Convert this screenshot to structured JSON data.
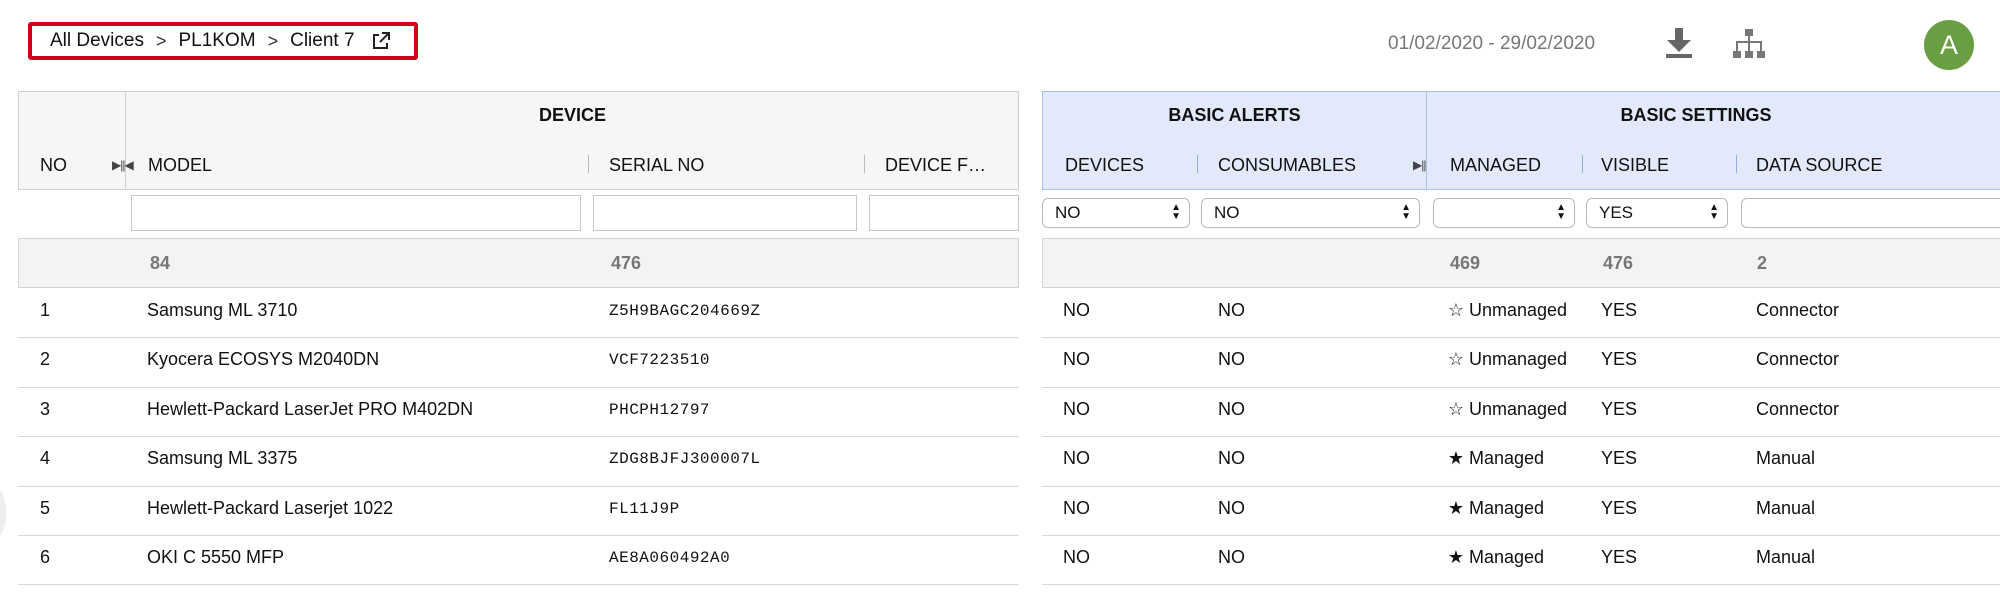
{
  "breadcrumb": {
    "items": [
      "All Devices",
      "PL1KOM",
      "Client 7"
    ],
    "separator": ">",
    "external_icon": "external-link-icon",
    "border_color": "#d0021b"
  },
  "date_range": "01/02/2020 - 29/02/2020",
  "toolbar": {
    "download_icon": "download-icon",
    "hierarchy_icon": "hierarchy-icon"
  },
  "avatar": {
    "initial": "A",
    "color": "#6a9e43"
  },
  "groups": {
    "device": "DEVICE",
    "basic_alerts": "BASIC ALERTS",
    "basic_settings": "BASIC SETTINGS"
  },
  "columns": {
    "no": "NO",
    "model": "MODEL",
    "serial": "SERIAL NO",
    "device_f": "DEVICE F…",
    "devices": "DEVICES",
    "consumables": "CONSUMABLES",
    "managed": "MANAGED",
    "visible": "VISIBLE",
    "data_source": "DATA SOURCE"
  },
  "filters": {
    "devices": "NO",
    "consumables": "NO",
    "managed": "",
    "visible": "YES",
    "data_source": ""
  },
  "totals": {
    "model": "84",
    "serial": "476",
    "managed": "469",
    "visible": "476",
    "data_source": "2"
  },
  "rows": [
    {
      "no": "1",
      "model": "Samsung ML 3710",
      "serial": "Z5H9BAGC204669Z",
      "devices": "NO",
      "consumables": "NO",
      "managed": "Unmanaged",
      "managed_icon": "star-outline-icon",
      "visible": "YES",
      "source": "Connector"
    },
    {
      "no": "2",
      "model": "Kyocera ECOSYS M2040DN",
      "serial": "VCF7223510",
      "devices": "NO",
      "consumables": "NO",
      "managed": "Unmanaged",
      "managed_icon": "star-outline-icon",
      "visible": "YES",
      "source": "Connector"
    },
    {
      "no": "3",
      "model": "Hewlett-Packard LaserJet PRO M402DN",
      "serial": "PHCPH12797",
      "devices": "NO",
      "consumables": "NO",
      "managed": "Unmanaged",
      "managed_icon": "star-outline-icon",
      "visible": "YES",
      "source": "Connector"
    },
    {
      "no": "4",
      "model": "Samsung ML 3375",
      "serial": "ZDG8BJFJ300007L",
      "devices": "NO",
      "consumables": "NO",
      "managed": "Managed",
      "managed_icon": "star-filled-icon",
      "visible": "YES",
      "source": "Manual"
    },
    {
      "no": "5",
      "model": "Hewlett-Packard Laserjet 1022",
      "serial": "FL11J9P",
      "devices": "NO",
      "consumables": "NO",
      "managed": "Managed",
      "managed_icon": "star-filled-icon",
      "visible": "YES",
      "source": "Manual"
    },
    {
      "no": "6",
      "model": "OKI C 5550 MFP",
      "serial": "AE8A060492A0",
      "devices": "NO",
      "consumables": "NO",
      "managed": "Managed",
      "managed_icon": "star-filled-icon",
      "visible": "YES",
      "source": "Manual"
    }
  ]
}
